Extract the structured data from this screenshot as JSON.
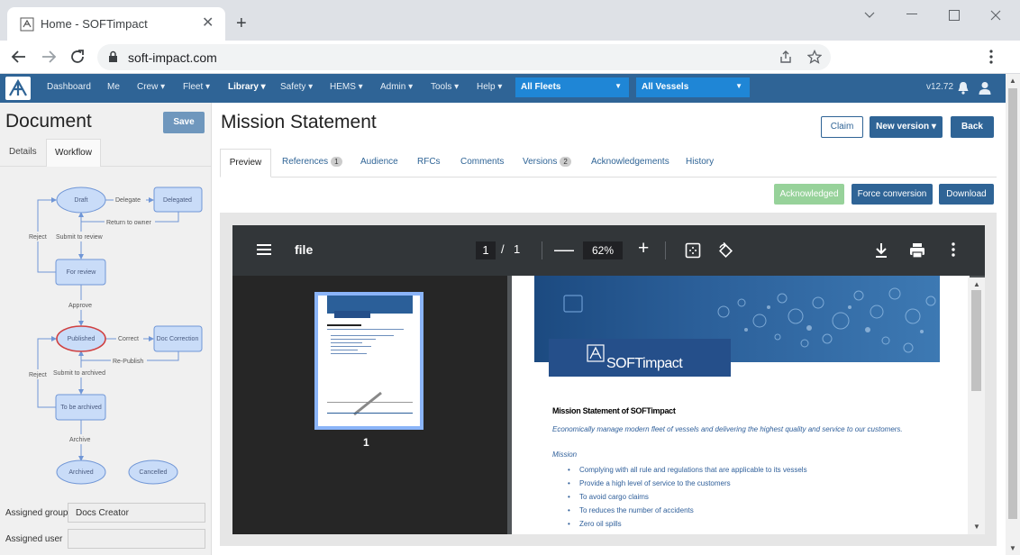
{
  "browser": {
    "tab_title": "Home - SOFTimpact",
    "url": "soft-impact.com",
    "new_tab": "+",
    "tab_close": "✕"
  },
  "nav": {
    "items": [
      "Dashboard",
      "Me",
      "Crew ▾",
      "Fleet ▾",
      "Library ▾",
      "Safety ▾",
      "HEMS ▾",
      "Admin ▾",
      "Tools ▾",
      "Help ▾"
    ],
    "fleet_select": "All Fleets",
    "vessel_select": "All Vessels",
    "version": "v12.72"
  },
  "left": {
    "title": "Document",
    "save": "Save",
    "tabs": {
      "details": "Details",
      "workflow": "Workflow"
    },
    "workflow": {
      "nodes": {
        "draft": "Draft",
        "delegated": "Delegated",
        "for_review": "For review",
        "published": "Published",
        "doc_correction": "Doc Correction",
        "to_be_archived": "To be archived",
        "archived": "Archived",
        "cancelled": "Cancelled"
      },
      "edges": {
        "delegate": "Delegate",
        "return_to_owner": "Return to owner",
        "reject1": "Reject",
        "submit_to_review": "Submit to review",
        "approve": "Approve",
        "correct": "Correct",
        "re_publish": "Re-Publish",
        "reject2": "Reject",
        "submit_to_archived": "Submit to archived",
        "archive": "Archive"
      }
    },
    "assigned_group_label": "Assigned group",
    "assigned_group_value": "Docs Creator",
    "assigned_user_label": "Assigned user",
    "assigned_user_value": ""
  },
  "main": {
    "title": "Mission Statement",
    "claim": "Claim",
    "new_version": "New version ▾",
    "back": "Back",
    "tabs": {
      "preview": "Preview",
      "references": "References",
      "references_count": "1",
      "audience": "Audience",
      "rfcs": "RFCs",
      "comments": "Comments",
      "versions": "Versions",
      "versions_count": "2",
      "acknowledgements": "Acknowledgements",
      "history": "History"
    },
    "acknowledged": "Acknowledged",
    "force_conversion": "Force conversion",
    "download": "Download"
  },
  "pdf": {
    "file": "file",
    "page": "1",
    "page_sep": "/",
    "page_total": "1",
    "zoom": "62%",
    "minus": "—",
    "plus": "+",
    "thumb_num": "1",
    "logo_text": "SOFTimpact",
    "heading": "Mission Statement of SOFTimpact",
    "subtitle": "Economically manage modern fleet of vessels and delivering the highest quality and service to our customers.",
    "mission_label": "Mission",
    "bullets": [
      "Complying with all rule and regulations that are applicable to its vessels",
      "Provide a high level of service to the customers",
      "To avoid cargo claims",
      "To reduces the number of accidents",
      "Zero oil spills"
    ]
  },
  "colors": {
    "nav_bg": "#2f6496",
    "select_bg": "#1f86d6",
    "acknowledged": "#97d29a",
    "workflow_node": "#c9dcf8"
  }
}
